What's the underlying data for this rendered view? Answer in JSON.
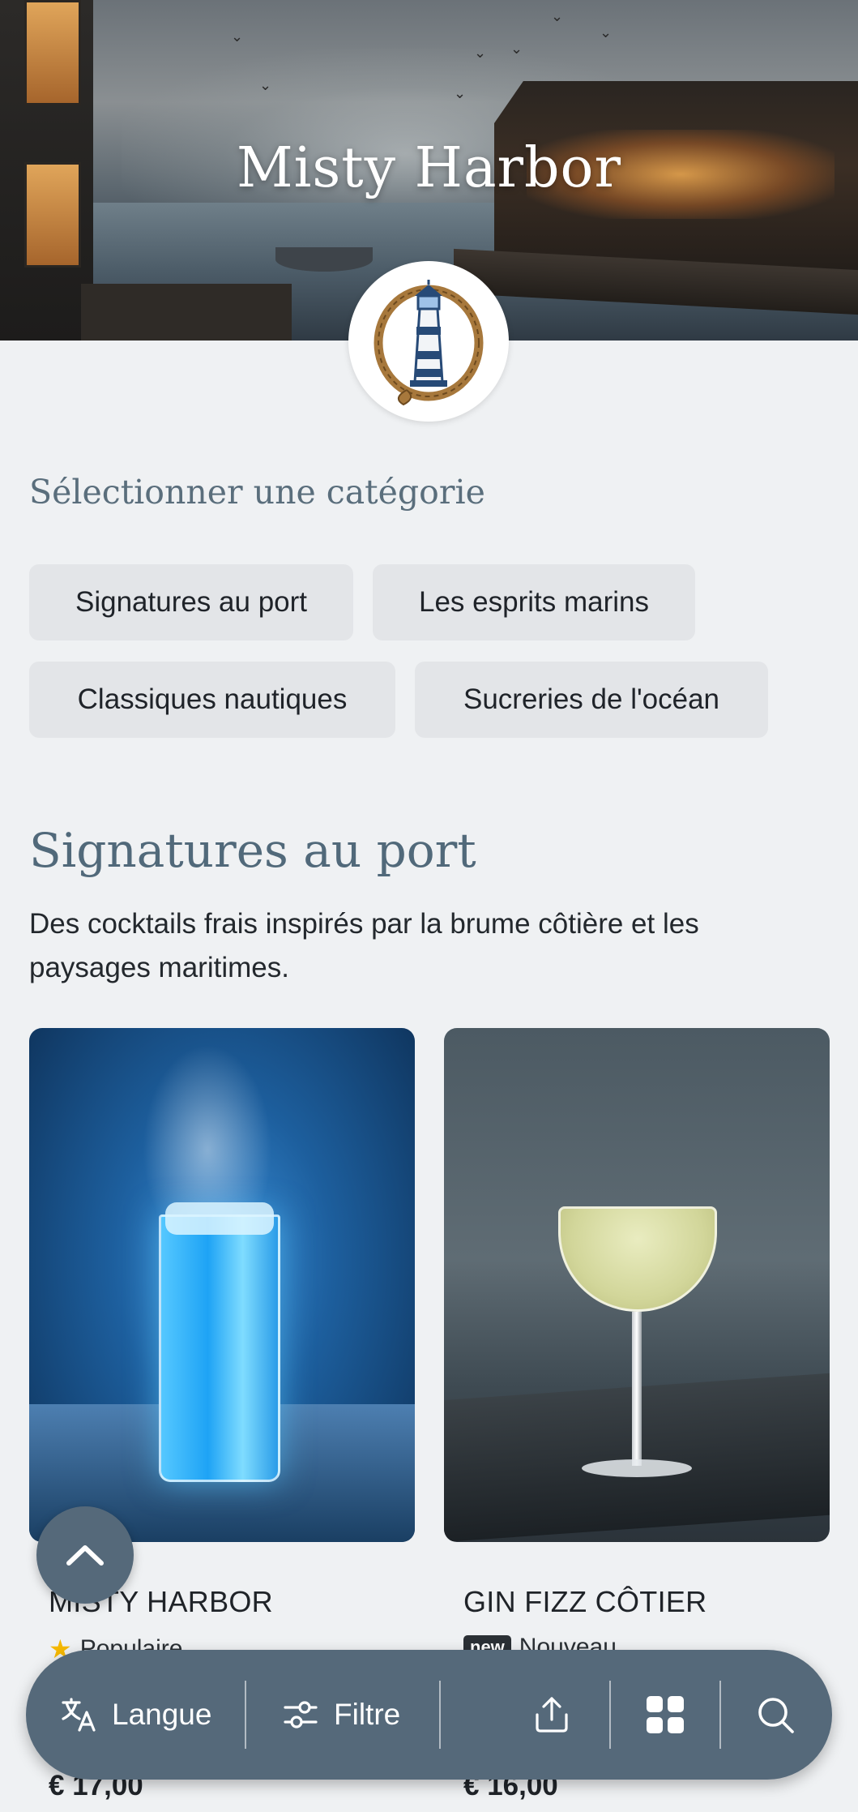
{
  "hero": {
    "title": "Misty Harbor"
  },
  "categories": {
    "heading": "Sélectionner une catégorie",
    "chips": [
      "Signatures au port",
      "Les esprits marins",
      "Classiques nautiques",
      "Sucreries de l'océan"
    ]
  },
  "section": {
    "title": "Signatures au port",
    "description": "Des cocktails frais inspirés par la brume côtière et les paysages maritimes."
  },
  "items": [
    {
      "name": "MISTY HARBOR",
      "tag": "Populaire",
      "price": "€ 17,00"
    },
    {
      "name": "GIN FIZZ CÔTIER",
      "badge": "new",
      "tag": "Nouveau",
      "price": "€ 16,00"
    }
  ],
  "bottom_bar": {
    "language": "Langue",
    "filter": "Filtre"
  },
  "colors": {
    "accent": "#55697a",
    "heading": "#5a6e7c",
    "chip_bg": "#e3e5e8",
    "page_bg": "#eff1f3",
    "star": "#f5b800"
  },
  "icons": [
    "chevron-up-icon",
    "translate-icon",
    "filter-icon",
    "share-icon",
    "grid-icon",
    "search-icon",
    "lighthouse-logo"
  ]
}
